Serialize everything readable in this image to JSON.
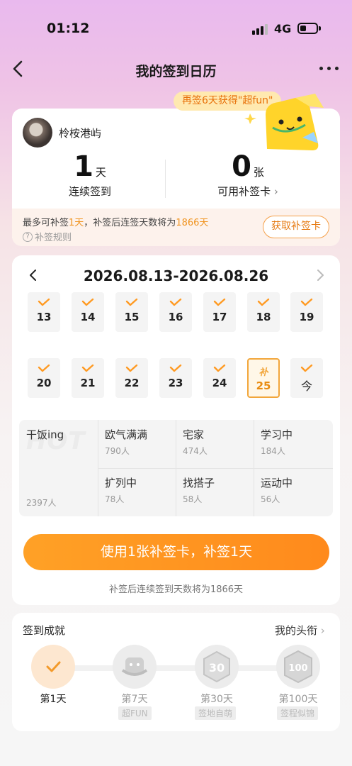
{
  "status_bar": {
    "time": "01:12",
    "network": "4G"
  },
  "nav": {
    "title": "我的签到日历"
  },
  "bubble": {
    "text": "再签6天获得\"超fun\""
  },
  "user": {
    "name": "柃桉港屿"
  },
  "stats": {
    "streak": {
      "value": "1",
      "unit": "天",
      "label": "连续签到"
    },
    "cards": {
      "value": "0",
      "unit": "张",
      "label": "可用补签卡"
    }
  },
  "makeup": {
    "note_prefix": "最多可补签",
    "note_days": "1天",
    "note_mid": "，补签后连签天数将为",
    "note_total": "1866天",
    "rule_label": "补签规则",
    "get_button": "获取补签卡"
  },
  "calendar": {
    "range": "2026.08.13-2026.08.26",
    "days": [
      {
        "label": "13",
        "state": "checked"
      },
      {
        "label": "14",
        "state": "checked"
      },
      {
        "label": "15",
        "state": "checked"
      },
      {
        "label": "16",
        "state": "checked"
      },
      {
        "label": "17",
        "state": "checked"
      },
      {
        "label": "18",
        "state": "checked"
      },
      {
        "label": "19",
        "state": "checked"
      },
      {
        "label": "20",
        "state": "checked"
      },
      {
        "label": "21",
        "state": "checked"
      },
      {
        "label": "22",
        "state": "checked"
      },
      {
        "label": "23",
        "state": "checked"
      },
      {
        "label": "24",
        "state": "checked"
      },
      {
        "label": "25",
        "state": "makeup",
        "mark": "补"
      },
      {
        "label": "今",
        "state": "today"
      }
    ]
  },
  "tags": {
    "watermark": "HOT",
    "main": {
      "name": "干饭ing",
      "count": "2397人"
    },
    "items": [
      {
        "name": "欧气满满",
        "count": "790人"
      },
      {
        "name": "宅家",
        "count": "474人"
      },
      {
        "name": "学习中",
        "count": "184人"
      },
      {
        "name": "扩列中",
        "count": "78人"
      },
      {
        "name": "找搭子",
        "count": "58人"
      },
      {
        "name": "运动中",
        "count": "56人"
      }
    ]
  },
  "action": {
    "button": "使用1张补签卡，补签1天",
    "tip": "补签后连续签到天数将为1866天"
  },
  "achievements": {
    "title": "签到成就",
    "link": "我的头衔",
    "badges": [
      {
        "label": "第1天",
        "tag": ""
      },
      {
        "label": "第7天",
        "tag": "超FUN"
      },
      {
        "label": "第30天",
        "tag": "签地自萌"
      },
      {
        "label": "第100天",
        "tag": "签程似锦"
      }
    ]
  },
  "colors": {
    "accent": "#ff9a22",
    "highlight": "#f09420",
    "makeup_border": "#f2a63b"
  }
}
